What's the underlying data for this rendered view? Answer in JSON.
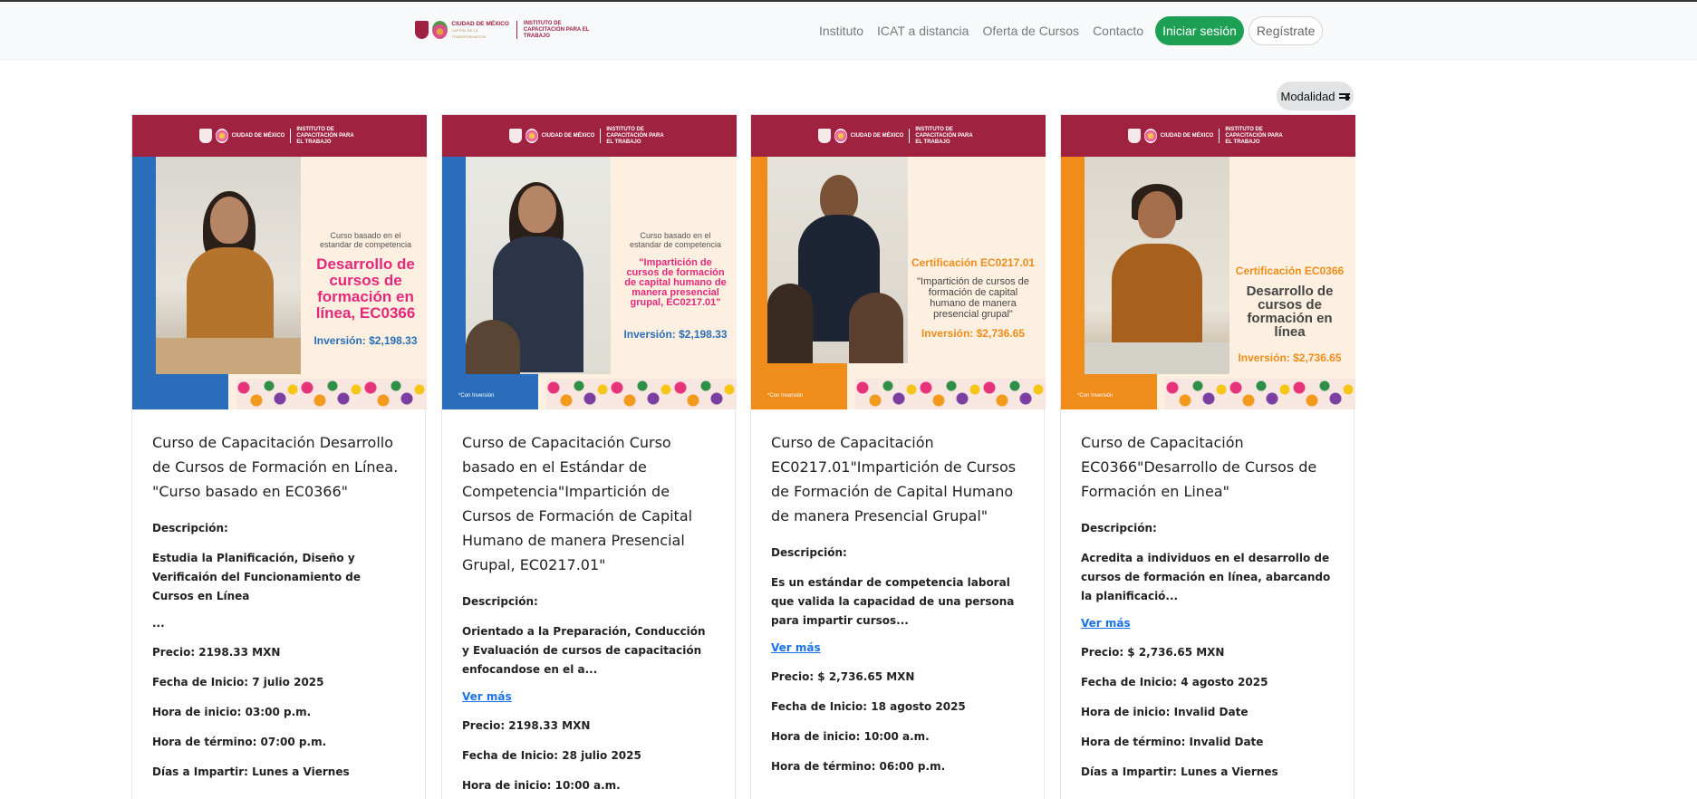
{
  "header": {
    "logo": {
      "city": "CIUDAD DE MÉXICO",
      "city_sub": "CAPITAL DE LA TRANSFORMACIÓN",
      "institute": "INSTITUTO DE CAPACITACIÓN PARA EL TRABAJO"
    },
    "nav": [
      "Instituto",
      "ICAT a distancia",
      "Oferta de Cursos",
      "Contacto"
    ],
    "login_label": "Iniciar sesión",
    "register_label": "Regístrate"
  },
  "filter": {
    "label": "Modalidad",
    "icon": "sliders-icon"
  },
  "colors": {
    "brand": "#9f2241",
    "login": "#1d9f54",
    "link": "#1a73e8",
    "pink": "#e4287a",
    "orange": "#ef8c1a",
    "blue": "#2a6ebb"
  },
  "cards": [
    {
      "banner": {
        "pretitle": "Curso basado en el estandar de competencia",
        "headline": "Desarrollo de cursos de formación en línea, EC0366",
        "price": "Inversión: $2,198.33",
        "note": ""
      },
      "title": "Curso de Capacitación Desarrollo de Cursos de Formación en Línea. \"Curso basado en EC0366\"",
      "desc_label": "Descripción:",
      "description": "Estudia la Planificación, Diseño y Verificaión del Funcionamiento de Cursos en Línea",
      "ellipsis": "...",
      "link": "",
      "price": "Precio: 2198.33 MXN",
      "start_date": "Fecha de Inicio: 7 julio 2025",
      "start_time": "Hora de inicio: 03:00 p.m.",
      "end_time": "Hora de término: 07:00 p.m.",
      "days": "Días a Impartir: Lunes a Viernes"
    },
    {
      "banner": {
        "pretitle": "Curso basado en el estandar de competencia",
        "headline": "\"Impartición de cursos de formación de capital humano de manera presencial grupal, EC0217.01\"",
        "price": "Inversión: $2,198.33",
        "note": "*Con Inversión"
      },
      "title": "Curso de Capacitación Curso basado en el Estándar de Competencia\"Impartición de Cursos de Formación de Capital Humano de manera Presencial Grupal, EC0217.01\"",
      "desc_label": "Descripción:",
      "description": "Orientado a la Preparación, Conducción y Evaluación de cursos de capacitación enfocandose en el a...",
      "ellipsis": "",
      "link": "Ver más",
      "price": "Precio: 2198.33 MXN",
      "start_date": "Fecha de Inicio: 28 julio 2025",
      "start_time": "Hora de inicio: 10:00 a.m.",
      "end_time": "",
      "days": ""
    },
    {
      "banner": {
        "pretitle": "Certificación EC0217.01",
        "headline": "\"Impartición de cursos de formación de capital humano de manera presencial grupal\"",
        "price": "Inversión: $2,736.65",
        "note": "*Con Inversión"
      },
      "title": "Curso de Capacitación EC0217.01\"Impartición de Cursos de Formación de Capital Humano de manera Presencial Grupal\"",
      "desc_label": "Descripción:",
      "description": "Es un estándar de competencia laboral que valida la capacidad de una persona para impartir cursos...",
      "ellipsis": "",
      "link": "Ver más",
      "price": "Precio: $ 2,736.65 MXN",
      "start_date": "Fecha de Inicio: 18 agosto 2025",
      "start_time": "Hora de inicio: 10:00 a.m.",
      "end_time": "Hora de término: 06:00 p.m.",
      "days": ""
    },
    {
      "banner": {
        "pretitle": "Certificación EC0366",
        "headline": "Desarrollo de cursos de formación en línea",
        "price": "Inversión: $2,736.65",
        "note": "*Con Inversión"
      },
      "title": "Curso de Capacitación EC0366\"Desarrollo de Cursos de Formación en Linea\"",
      "desc_label": "Descripción:",
      "description": "Acredita a individuos en el desarrollo de cursos de formación en línea, abarcando la planificació...",
      "ellipsis": "",
      "link": "Ver más",
      "price": "Precio: $ 2,736.65 MXN",
      "start_date": "Fecha de Inicio: 4 agosto 2025",
      "start_time": "Hora de inicio: Invalid Date",
      "end_time": "Hora de término: Invalid Date",
      "days": "Días a Impartir: Lunes a Viernes"
    }
  ]
}
